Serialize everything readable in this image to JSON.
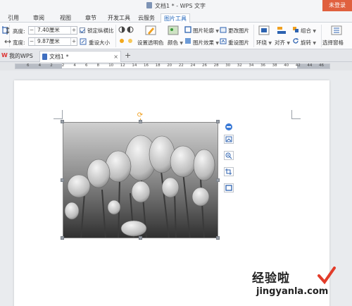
{
  "window": {
    "title": "文档1 * - WPS 文字",
    "login_label": "未登录"
  },
  "menu": {
    "items": [
      "引用",
      "审阅",
      "视图",
      "章节",
      "开发工具",
      "云服务",
      "图片工具"
    ],
    "active": "图片工具"
  },
  "ribbon": {
    "height_label": "高度:",
    "height_value": "7.40厘米",
    "width_label": "宽度:",
    "width_value": "9.87厘米",
    "lock_ratio_label": "锁定纵横比",
    "lock_ratio_checked": true,
    "reset_size_label": "重设大小",
    "set_transparent_label": "设置透明色",
    "color_label": "颜色",
    "picture_outline_label": "图片轮廓",
    "picture_effect_label": "图片效果",
    "change_picture_label": "更改图片",
    "reset_picture_label": "重设图片",
    "wrap_label": "环绕",
    "align_label": "对齐",
    "group_label": "组合",
    "rotate_label": "旋转",
    "selection_pane_label": "选择窗格",
    "accent_color": "#2c62b0"
  },
  "tabs": {
    "my_wps_label": "我的WPS",
    "doc_label": "文档1 *",
    "add_icon": "plus-icon",
    "close_icon": "close-icon"
  },
  "ruler": {
    "numbers": [
      "6",
      "4",
      "2",
      "2",
      "4",
      "6",
      "8",
      "10",
      "12",
      "14",
      "16",
      "18",
      "20",
      "22",
      "24",
      "26",
      "28",
      "30",
      "32",
      "34",
      "36",
      "38",
      "40",
      "42",
      "44",
      "46"
    ]
  },
  "watermark": {
    "main_text": "经验啦",
    "sub_text": "jingyanla.com"
  }
}
